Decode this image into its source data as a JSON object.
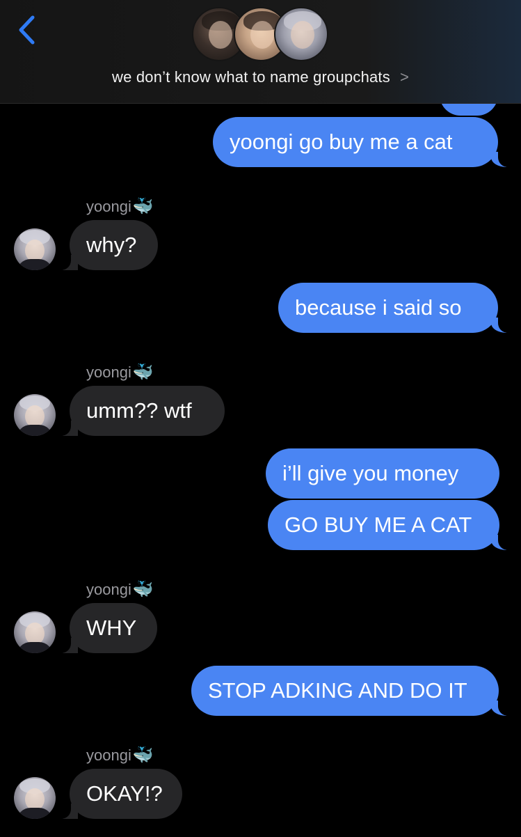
{
  "header": {
    "back_icon": "chevron-left-icon",
    "group_name": "we don’t know what to name groupchats",
    "chevron": ">",
    "colors": {
      "back": "#2f7bf5"
    }
  },
  "messages": [
    {
      "type": "sent",
      "text": "yoongi go buy me a cat"
    },
    {
      "type": "received",
      "sender": "yoongi",
      "sender_emoji": "🐳",
      "text": "why?"
    },
    {
      "type": "sent",
      "text": "because i said so"
    },
    {
      "type": "received",
      "sender": "yoongi",
      "sender_emoji": "🐳",
      "text": "umm?? wtf"
    },
    {
      "type": "sent",
      "text": "i’ll give you money"
    },
    {
      "type": "sent",
      "text": "GO BUY ME A CAT"
    },
    {
      "type": "received",
      "sender": "yoongi",
      "sender_emoji": "🐳",
      "text": "WHY"
    },
    {
      "type": "sent",
      "text": "STOP ADKING AND DO IT"
    },
    {
      "type": "received",
      "sender": "yoongi",
      "sender_emoji": "🐳",
      "text": "OKAY!?"
    }
  ],
  "colors": {
    "sent_bubble": "#4a85f3",
    "received_bubble": "#262628",
    "background": "#000000"
  }
}
